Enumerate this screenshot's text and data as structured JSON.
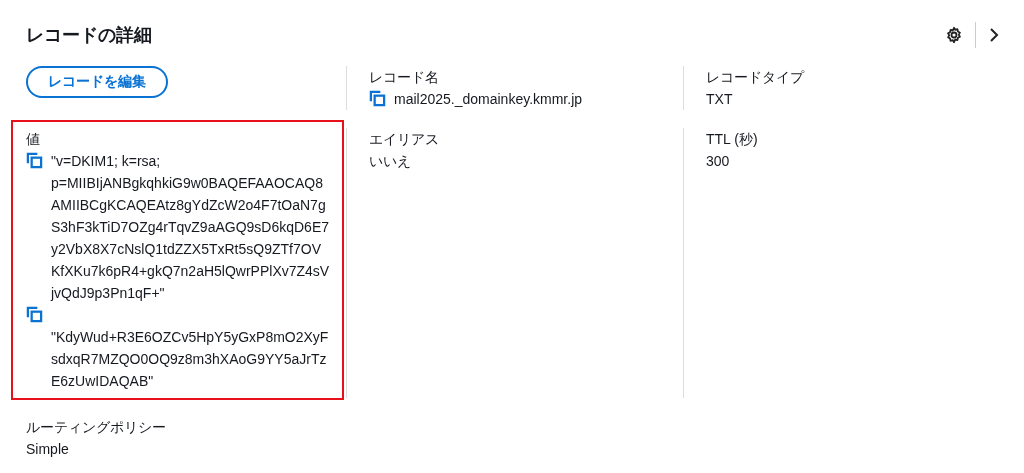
{
  "panel": {
    "title": "レコードの詳細"
  },
  "edit_button": {
    "label": "レコードを編集"
  },
  "fields": [
    {
      "label": "レコード名",
      "values": [
        {
          "text": "mail2025._domainkey.kmmr.jp",
          "copyable": true
        }
      ],
      "highlighted": false
    },
    {
      "label": "レコードタイプ",
      "values": [
        {
          "text": "TXT",
          "copyable": false
        }
      ],
      "highlighted": false
    },
    {
      "label": "値",
      "values": [
        {
          "text": "\"v=DKIM1; k=rsa; p=MIIBIjANBgkqhkiG9w0BAQEFAAOCAQ8AMIIBCgKCAQEAtz8gYdZcW2o4F7tOaN7gS3hF3kTiD7OZg4rTqvZ9aAGQ9sD6kqD6E7y2VbX8X7cNslQ1tdZZX5TxRt5sQ9ZTf7OVKfXKu7k6pR4+gkQ7n2aH5lQwrPPlXv7Z4sVjvQdJ9p3Pn1qF+\"",
          "copyable": true
        },
        {
          "text": " \"KdyWud+R3E6OZCv5HpY5yGxP8mO2XyFsdxqR7MZQO0OQ9z8m3hXAoG9YY5aJrTzE6zUwIDAQAB\"",
          "copyable": true
        }
      ],
      "highlighted": true
    },
    {
      "label": "エイリアス",
      "values": [
        {
          "text": "いいえ",
          "copyable": false
        }
      ],
      "highlighted": false
    },
    {
      "label": "TTL (秒)",
      "values": [
        {
          "text": "300",
          "copyable": false
        }
      ],
      "highlighted": false
    },
    {
      "label": "ルーティングポリシー",
      "values": [
        {
          "text": "Simple",
          "copyable": false
        }
      ],
      "highlighted": false
    }
  ]
}
